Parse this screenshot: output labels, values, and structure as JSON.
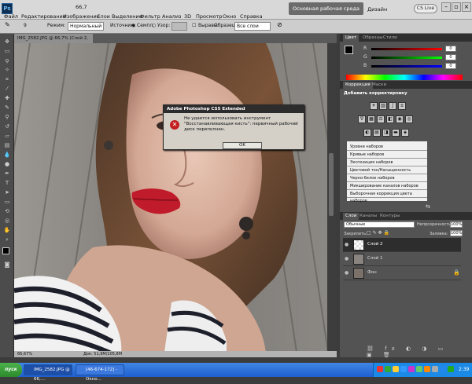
{
  "app": {
    "logo": "Ps",
    "workspace": "Основная рабочая среда",
    "design": "Дизайн",
    "cslive": "CS Live"
  },
  "menu": [
    "Файл",
    "Редактирование",
    "Изображение",
    "Слои",
    "Выделение",
    "Фильтр",
    "Анализ",
    "3D",
    "Просмотр",
    "Окно",
    "Справка"
  ],
  "menu_extra": {
    "zoom": "66,7",
    "cslive_menu": "CS Live"
  },
  "options": {
    "brush_size": "9",
    "mode_label": "Режим:",
    "mode_value": "Нормальный",
    "source_label": "Источник:",
    "sample_label": "Семпл.",
    "pattern_label": "Узор:",
    "align_label": "Выравн.",
    "sample2_label": "Образец:",
    "sample2_value": "Все слои"
  },
  "document": {
    "tab": "IMG_2582.JPG @ 66,7% (Слой 2, RGB/8) *",
    "zoom": "66,67%",
    "doc_size": "Док: 51,9M/105,8M"
  },
  "color_panel": {
    "tabs": [
      "Цвет",
      "Образцы",
      "Стили"
    ],
    "labels": [
      "R",
      "G",
      "B"
    ],
    "values": [
      "0",
      "0",
      "0"
    ]
  },
  "adjust_panel": {
    "tabs": [
      "Коррекция",
      "Маски"
    ],
    "title": "Добавить корректировку",
    "presets": [
      "Уровни наборов",
      "Кривые наборов",
      "Экспозиция наборов",
      "Цветовой тон/Насыщенность наборов",
      "Черно-белое наборов",
      "Микширование каналов наборов",
      "Выборочная коррекция цвета наборов"
    ]
  },
  "layers_panel": {
    "tabs": [
      "Слои",
      "Каналы",
      "Контуры"
    ],
    "blend": "Обычные",
    "opacity_label": "Непрозрачность:",
    "opacity": "100%",
    "lock_label": "Закрепить:",
    "fill_label": "Заливка:",
    "fill": "100%",
    "layers": [
      "Слой 2",
      "Слой 1",
      "Фон"
    ]
  },
  "dialog": {
    "title": "Adobe Photoshop CS5 Extended",
    "message": "Не удается использовать инструмент \"Восстанавливающая кисть\": первичный рабочий диск переполнен.",
    "ok": "OK"
  },
  "taskbar": {
    "start": "пуск",
    "buttons": [
      "IMG_2582.JPG @ 66,...",
      "[46-674-172] - Окно..."
    ],
    "clock": "2:39"
  },
  "colors": {
    "accent_red": "#c21f1f",
    "panel_bg": "#535353",
    "taskbar": "#1f5fcf"
  }
}
